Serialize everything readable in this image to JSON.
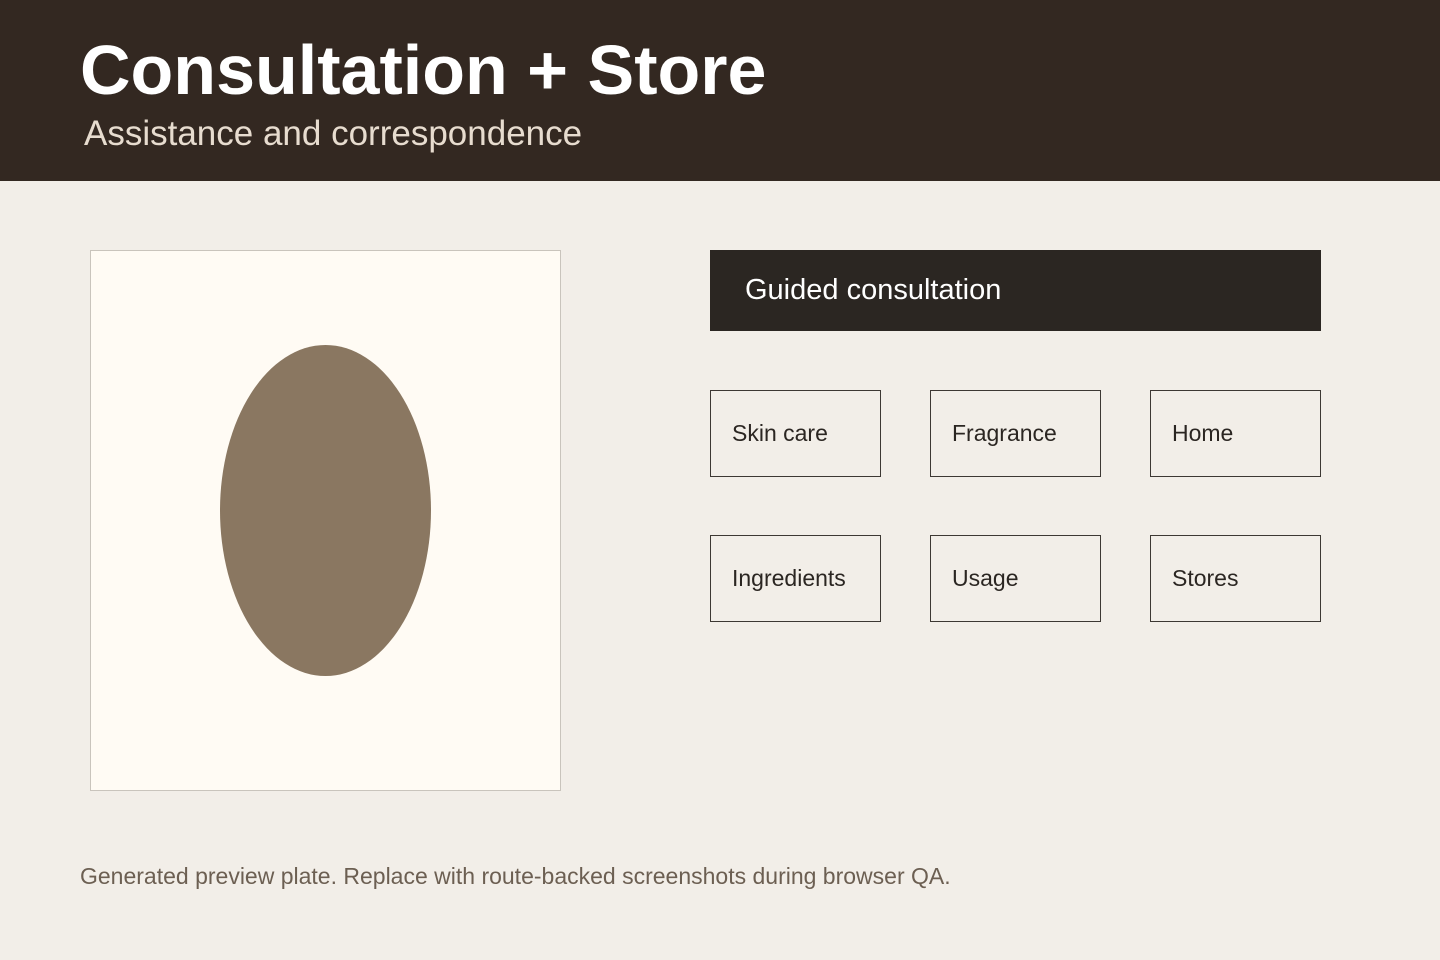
{
  "header": {
    "title": "Consultation + Store",
    "subtitle": "Assistance and correspondence"
  },
  "preview": {
    "oval_color": "#8a7761"
  },
  "primary_action": {
    "label": "Guided consultation"
  },
  "tiles": [
    {
      "label": "Skin care"
    },
    {
      "label": "Fragrance"
    },
    {
      "label": "Home"
    },
    {
      "label": "Ingredients"
    },
    {
      "label": "Usage"
    },
    {
      "label": "Stores"
    }
  ],
  "footnote": "Generated preview plate. Replace with route-backed screenshots during browser QA.",
  "colors": {
    "header_bg": "#332821",
    "page_bg": "#f2eee8",
    "button_bg": "#2b2622",
    "panel_bg": "#fffbf4"
  }
}
